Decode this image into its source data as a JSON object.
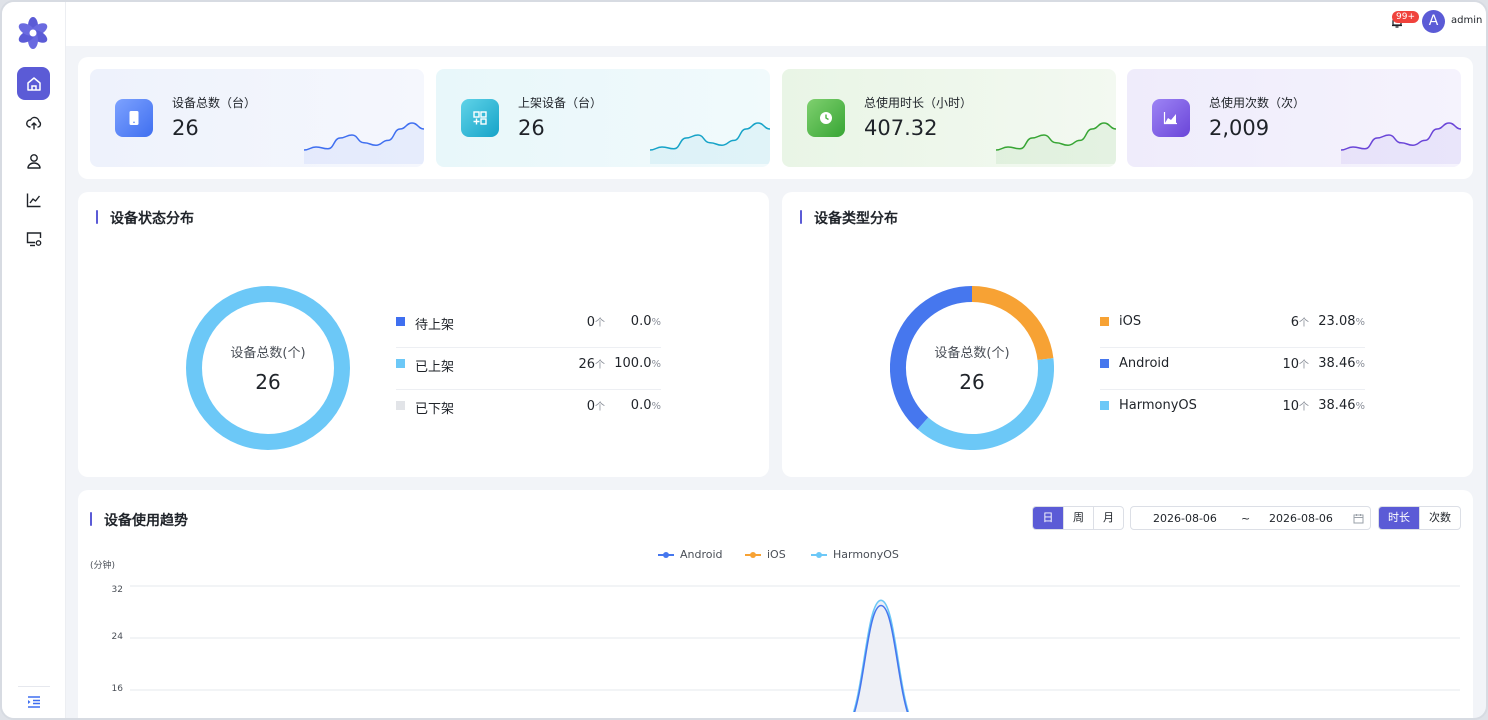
{
  "header": {
    "badge": "99+",
    "avatar_letter": "A",
    "username": "admin"
  },
  "sidebar": {
    "items": [
      {
        "name": "home",
        "icon": "home-icon",
        "active": true
      },
      {
        "name": "cloud",
        "icon": "cloud-upload-icon",
        "active": false
      },
      {
        "name": "user",
        "icon": "user-icon",
        "active": false
      },
      {
        "name": "analytics",
        "icon": "line-chart-icon",
        "active": false
      },
      {
        "name": "device-settings",
        "icon": "monitor-settings-icon",
        "active": false
      }
    ]
  },
  "stats": [
    {
      "label": "设备总数（台）",
      "value": "26",
      "icon": "tablet-icon",
      "color": "#3f6ff0",
      "trend": [
        2,
        2.5,
        2.2,
        4,
        4.5,
        3.2,
        2.8,
        3.6,
        5.5,
        6.5,
        5.5
      ]
    },
    {
      "label": "上架设备（台）",
      "value": "26",
      "icon": "apps-icon",
      "color": "#16a3c8",
      "trend": [
        2,
        2.5,
        2.2,
        4,
        4.5,
        3.2,
        2.8,
        3.6,
        5.5,
        6.5,
        5.5
      ]
    },
    {
      "label": "总使用时长（小时）",
      "value": "407.32",
      "icon": "clock-icon",
      "color": "#37a534",
      "trend": [
        2,
        2.5,
        2.2,
        4,
        4.5,
        3.2,
        2.8,
        3.6,
        5.5,
        6.5,
        5.5
      ]
    },
    {
      "label": "总使用次数（次）",
      "value": "2,009",
      "icon": "area-chart-icon",
      "color": "#6a45d8",
      "trend": [
        2,
        2.5,
        2.2,
        4,
        4.5,
        3.2,
        2.8,
        3.6,
        5.5,
        6.5,
        5.5
      ]
    }
  ],
  "status_panel": {
    "title": "设备状态分布",
    "center_label": "设备总数(个)",
    "center_value": "26",
    "unit": "个",
    "rows": [
      {
        "name": "待上架",
        "count": "0",
        "pct": "0.0",
        "color": "#3f6ff0",
        "value": 0
      },
      {
        "name": "已上架",
        "count": "26",
        "pct": "100.0",
        "color": "#6cc8f7",
        "value": 26
      },
      {
        "name": "已下架",
        "count": "0",
        "pct": "0.0",
        "color": "#e2e4e8",
        "value": 0
      }
    ]
  },
  "type_panel": {
    "title": "设备类型分布",
    "center_label": "设备总数(个)",
    "center_value": "26",
    "unit": "个",
    "rows": [
      {
        "name": "iOS",
        "count": "6",
        "pct": "23.08",
        "color": "#f7a234",
        "value": 6
      },
      {
        "name": "Android",
        "count": "10",
        "pct": "38.46",
        "color": "#4677ee",
        "value": 10
      },
      {
        "name": "HarmonyOS",
        "count": "10",
        "pct": "38.46",
        "color": "#6cc8f7",
        "value": 10
      }
    ]
  },
  "trend_panel": {
    "title": "设备使用趋势",
    "period_tabs": [
      "日",
      "周",
      "月"
    ],
    "period_active": "日",
    "date_start": "2026-08-06",
    "date_sep": "~",
    "date_end": "2026-08-06",
    "metric_tabs": [
      "时长",
      "次数"
    ],
    "metric_active": "时长"
  },
  "chart_data": {
    "type": "area",
    "ylabel": "(分钟)",
    "y_ticks": [
      32,
      24,
      16
    ],
    "series": [
      {
        "name": "Android",
        "color": "#4677ee"
      },
      {
        "name": "iOS",
        "color": "#f7a234"
      },
      {
        "name": "HarmonyOS",
        "color": "#6cc8f7"
      }
    ],
    "peak_android": 29,
    "peak_harmonyos": 29.8
  },
  "percent_sign": "%"
}
